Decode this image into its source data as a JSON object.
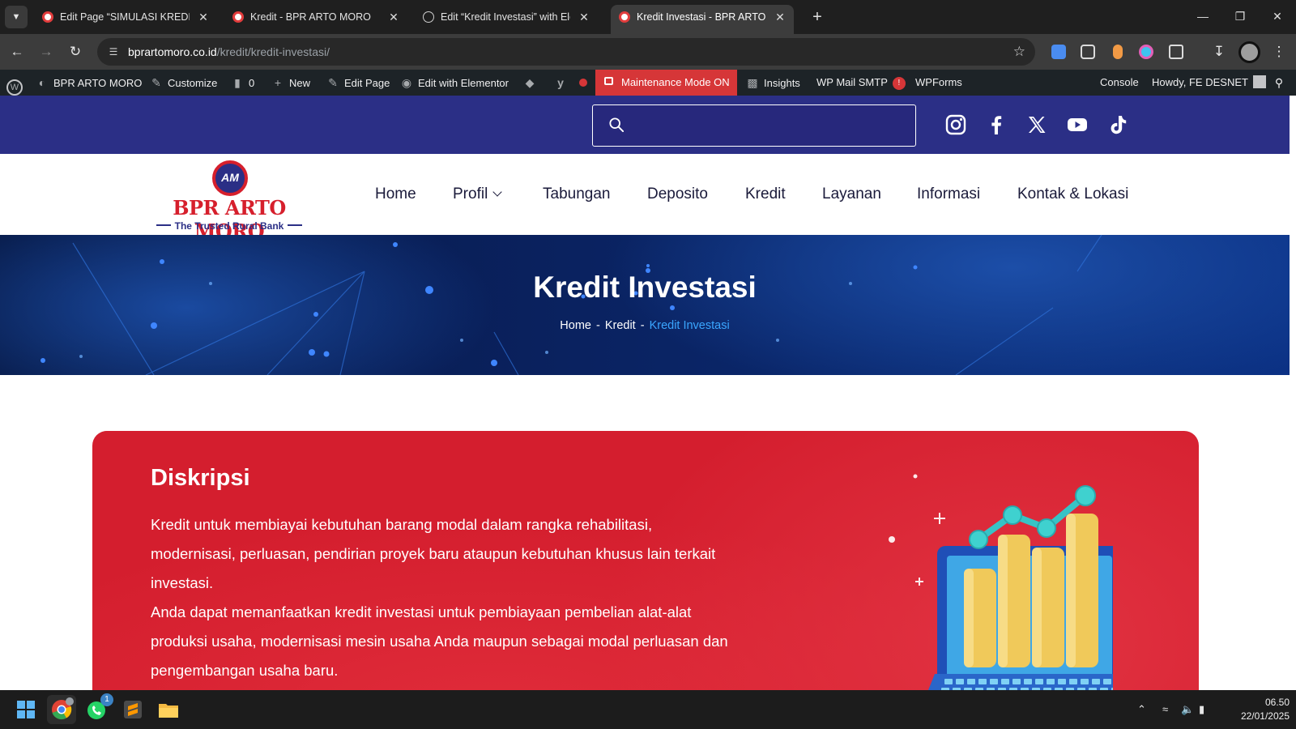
{
  "browser": {
    "tabs": [
      {
        "title": "Edit Page “SIMULASI KREDIT BPR ARTO MORO”",
        "favicon": "bpr-favicon",
        "active": false
      },
      {
        "title": "Kredit - BPR ARTO MORO",
        "favicon": "bpr-favicon",
        "active": false
      },
      {
        "title": "Edit “Kredit Investasi” with Elementor",
        "favicon": "globe-icon",
        "active": false
      },
      {
        "title": "Kredit Investasi - BPR ARTO MORO",
        "favicon": "bpr-favicon",
        "active": true
      }
    ],
    "url_host": "bprartomoro.co.id",
    "url_path": "/kredit/kredit-investasi/"
  },
  "wp_admin_bar": {
    "site_name": "BPR ARTO MORO",
    "customize": "Customize",
    "comments_count": "0",
    "new": "New",
    "edit_page": "Edit Page",
    "edit_elementor": "Edit with Elementor",
    "maintenance": "Maintenance Mode ON",
    "insights": "Insights",
    "wp_mail": "WP Mail SMTP",
    "wp_mail_badge": "!",
    "wpforms": "WPForms",
    "console": "Console",
    "howdy": "Howdy, FE DESNET"
  },
  "topbar": {
    "search_placeholder": "",
    "social": [
      "instagram-icon",
      "facebook-icon",
      "x-icon",
      "youtube-icon",
      "tiktok-icon"
    ]
  },
  "logo": {
    "name": "BPR ARTO MORO",
    "tagline": "The Trusted Rural Bank"
  },
  "nav": [
    "Home",
    "Profil",
    "Tabungan",
    "Deposito",
    "Kredit",
    "Layanan",
    "Informasi",
    "Kontak & Lokasi"
  ],
  "hero": {
    "title": "Kredit Investasi",
    "breadcrumb": [
      "Home",
      "Kredit",
      "Kredit Investasi"
    ],
    "separator": "-"
  },
  "content": {
    "heading": "Diskripsi",
    "paragraph1": "Kredit untuk membiayai kebutuhan barang modal dalam rangka rehabilitasi, modernisasi, perluasan, pendirian proyek baru ataupun kebutuhan khusus lain terkait investasi.",
    "paragraph2": "Anda dapat memanfaatkan kredit investasi untuk pembiayaan pembelian alat-alat produksi usaha, modernisasi mesin usaha Anda maupun sebagai modal perluasan dan pengembangan usaha baru."
  },
  "taskbar": {
    "apps": [
      "windows-start-icon",
      "chrome-icon",
      "whatsapp-icon",
      "sublime-text-icon",
      "file-explorer-icon"
    ],
    "whatsapp_badge": "1",
    "time": "06.50",
    "date": "22/01/2025"
  },
  "colors": {
    "topbar": "#2b2f86",
    "brand_red": "#d61f2c",
    "card_red": "#d41e2e",
    "breadcrumb_current": "#3aa6ff",
    "hero_dark": "#061640"
  }
}
